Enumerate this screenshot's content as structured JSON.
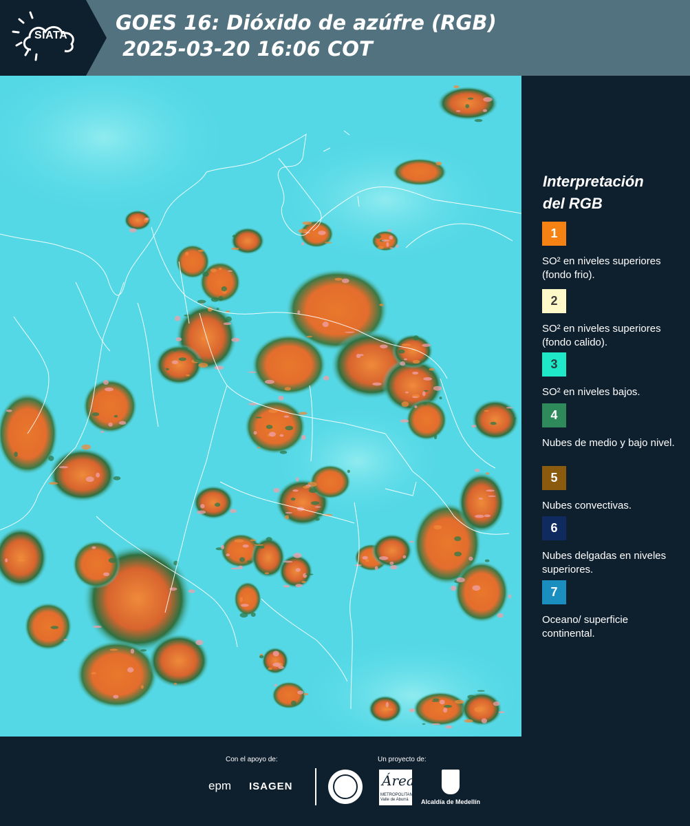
{
  "header": {
    "logo": "SIATA",
    "title_line1": "GOES 16: Dióxido de azúfre (RGB)",
    "title_line2": "2025-03-20 16:06 COT"
  },
  "legend": {
    "title_line1": "Interpretación",
    "title_line2": "del RGB",
    "items": [
      {
        "number": "1",
        "color": "#f58213",
        "text_color": "#ffffff",
        "label": "SO² en niveles superiores (fondo frio)."
      },
      {
        "number": "2",
        "color": "#fff9c9",
        "text_color": "#3a3a3a",
        "label": "SO² en niveles superiores (fondo calido)."
      },
      {
        "number": "3",
        "color": "#1fe8c8",
        "text_color": "#244040",
        "label": "SO² en niveles bajos."
      },
      {
        "number": "4",
        "color": "#2e8a5a",
        "text_color": "#ffffff",
        "label": "Nubes de medio y bajo nivel."
      },
      {
        "number": "5",
        "color": "#8a5a0f",
        "text_color": "#ffffff",
        "label": "Nubes convectivas."
      },
      {
        "number": "6",
        "color": "#0f2a5e",
        "text_color": "#ffffff",
        "label": "Nubes delgadas en niveles superiores."
      },
      {
        "number": "7",
        "color": "#1a8fbf",
        "text_color": "#ffffff",
        "label": "Oceano/ superficie continental."
      }
    ]
  },
  "footer": {
    "support_label": "Con el apoyo de:",
    "project_label": "Un proyecto de:",
    "sponsors": [
      "epm",
      "ISAGEN"
    ],
    "area_logo": "Área",
    "area_subtitle": "METROPOLITANA Valle de Aburrá",
    "alcaldia": "Alcaldía de Medellín"
  },
  "colors": {
    "map_background": "#57dbe8",
    "cloud_orange": "#e8772a",
    "cloud_green": "#2f7a48",
    "cloud_pink": "#f0a0a8",
    "header_bg": "#52727f",
    "panel_bg": "#0e1f2e"
  }
}
